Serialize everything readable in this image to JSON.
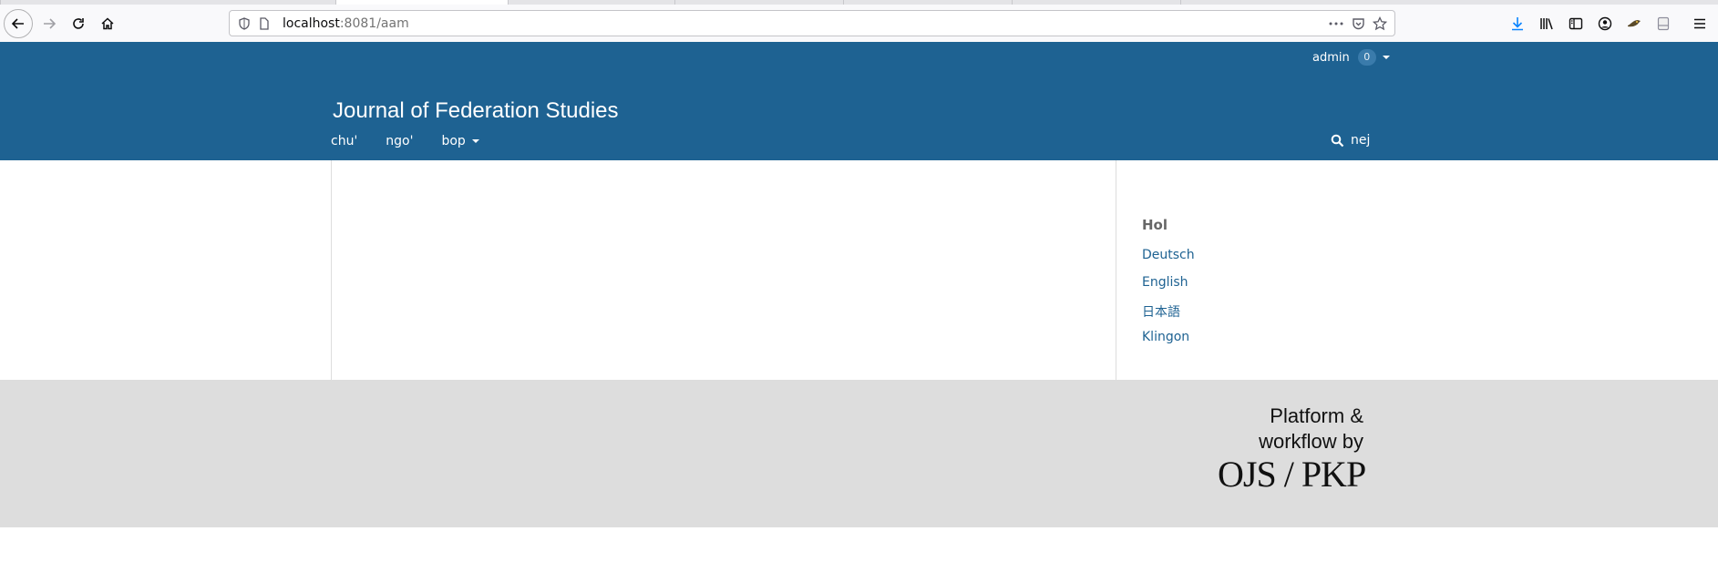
{
  "browser": {
    "url_host": "localhost",
    "url_path": ":8081/aam",
    "icons": [
      "back-icon",
      "forward-icon",
      "reload-icon",
      "home-icon",
      "shield-icon",
      "page-icon",
      "more-icon",
      "pocket-icon",
      "star-icon",
      "download-icon",
      "library-icon",
      "sidebar-icon",
      "account-icon",
      "extension-icon",
      "reader-icon",
      "menu-icon"
    ]
  },
  "header": {
    "user_name": "admin",
    "notification_count": "0",
    "site_title": "Journal of Federation Studies",
    "nav": [
      {
        "label": "chu'"
      },
      {
        "label": "ngo'"
      },
      {
        "label": "bop"
      }
    ],
    "search_label": "nej"
  },
  "sidebar": {
    "heading": "Hol",
    "languages": [
      "Deutsch",
      "English",
      "日本語",
      "Klingon"
    ]
  },
  "footer": {
    "line1": "Platform &",
    "line2": "workflow by",
    "logo": "OJS / PKP"
  },
  "colors": {
    "header_bg": "#1e6292",
    "link": "#1e6292",
    "footer_bg": "#dddddd"
  }
}
